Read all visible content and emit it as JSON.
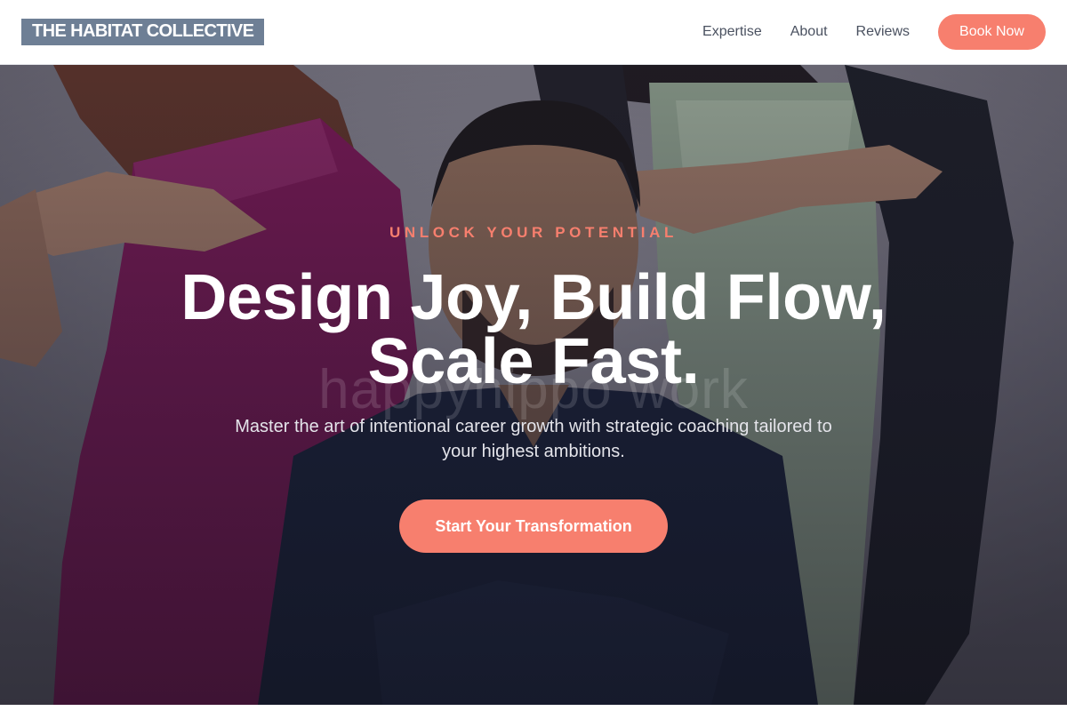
{
  "header": {
    "brand": "THE HABITAT COLLECTIVE",
    "nav": [
      "Expertise",
      "About",
      "Reviews"
    ],
    "cta": "Book Now"
  },
  "hero": {
    "watermark": "happyhippo work",
    "eyebrow": "UNLOCK YOUR POTENTIAL",
    "headline_line1": "Design Joy, Build Flow,",
    "headline_line2": "Scale Fast.",
    "subtext": "Master the art of intentional career growth with strategic coaching tailored to your highest ambitions.",
    "cta": "Start Your Transformation"
  },
  "colors": {
    "accent": "#f77f6e",
    "brand_bg": "#6e7f95"
  }
}
